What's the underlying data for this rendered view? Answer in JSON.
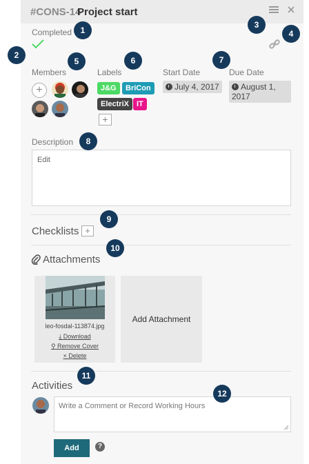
{
  "header": {
    "card_id": "#CONS-14",
    "title": "Project start",
    "menu_icon": "hamburger-menu-icon",
    "close_icon": "close-icon"
  },
  "status": {
    "label": "Completed",
    "icon": "checkmark-icon"
  },
  "link_icon": "link-icon",
  "members": {
    "label": "Members",
    "add_icon": "plus-icon"
  },
  "labels": {
    "label": "Labels",
    "tags": [
      {
        "text": "J&G",
        "color": "#4cd964"
      },
      {
        "text": "BriCon",
        "color": "#1f9cb5"
      },
      {
        "text": "ElectriX",
        "color": "#444444"
      },
      {
        "text": "IT",
        "color": "#e8168a"
      }
    ],
    "add_icon": "plus-icon"
  },
  "start_date": {
    "label": "Start Date",
    "value": "July 4, 2017"
  },
  "due_date": {
    "label": "Due Date",
    "value_line1": "August 1,",
    "value_line2": "2017"
  },
  "description": {
    "label": "Description",
    "value": "Edit"
  },
  "checklists": {
    "title": "Checklists"
  },
  "attachments": {
    "title": "Attachments",
    "file": {
      "name": "leo-fosdal-113874.jpg",
      "download": "Download",
      "remove_cover": "Remove Cover",
      "delete": "Delete"
    },
    "add_label": "Add Attachment"
  },
  "activities": {
    "title": "Activities",
    "comment_placeholder": "Write a Comment or Record Working Hours",
    "add_button": "Add",
    "help": "?"
  },
  "badges": [
    "1",
    "2",
    "3",
    "4",
    "5",
    "6",
    "7",
    "8",
    "9",
    "10",
    "11",
    "12"
  ],
  "colors": {
    "accent": "#1e6a7a",
    "badge": "#163a5c",
    "check": "#4cd964"
  }
}
